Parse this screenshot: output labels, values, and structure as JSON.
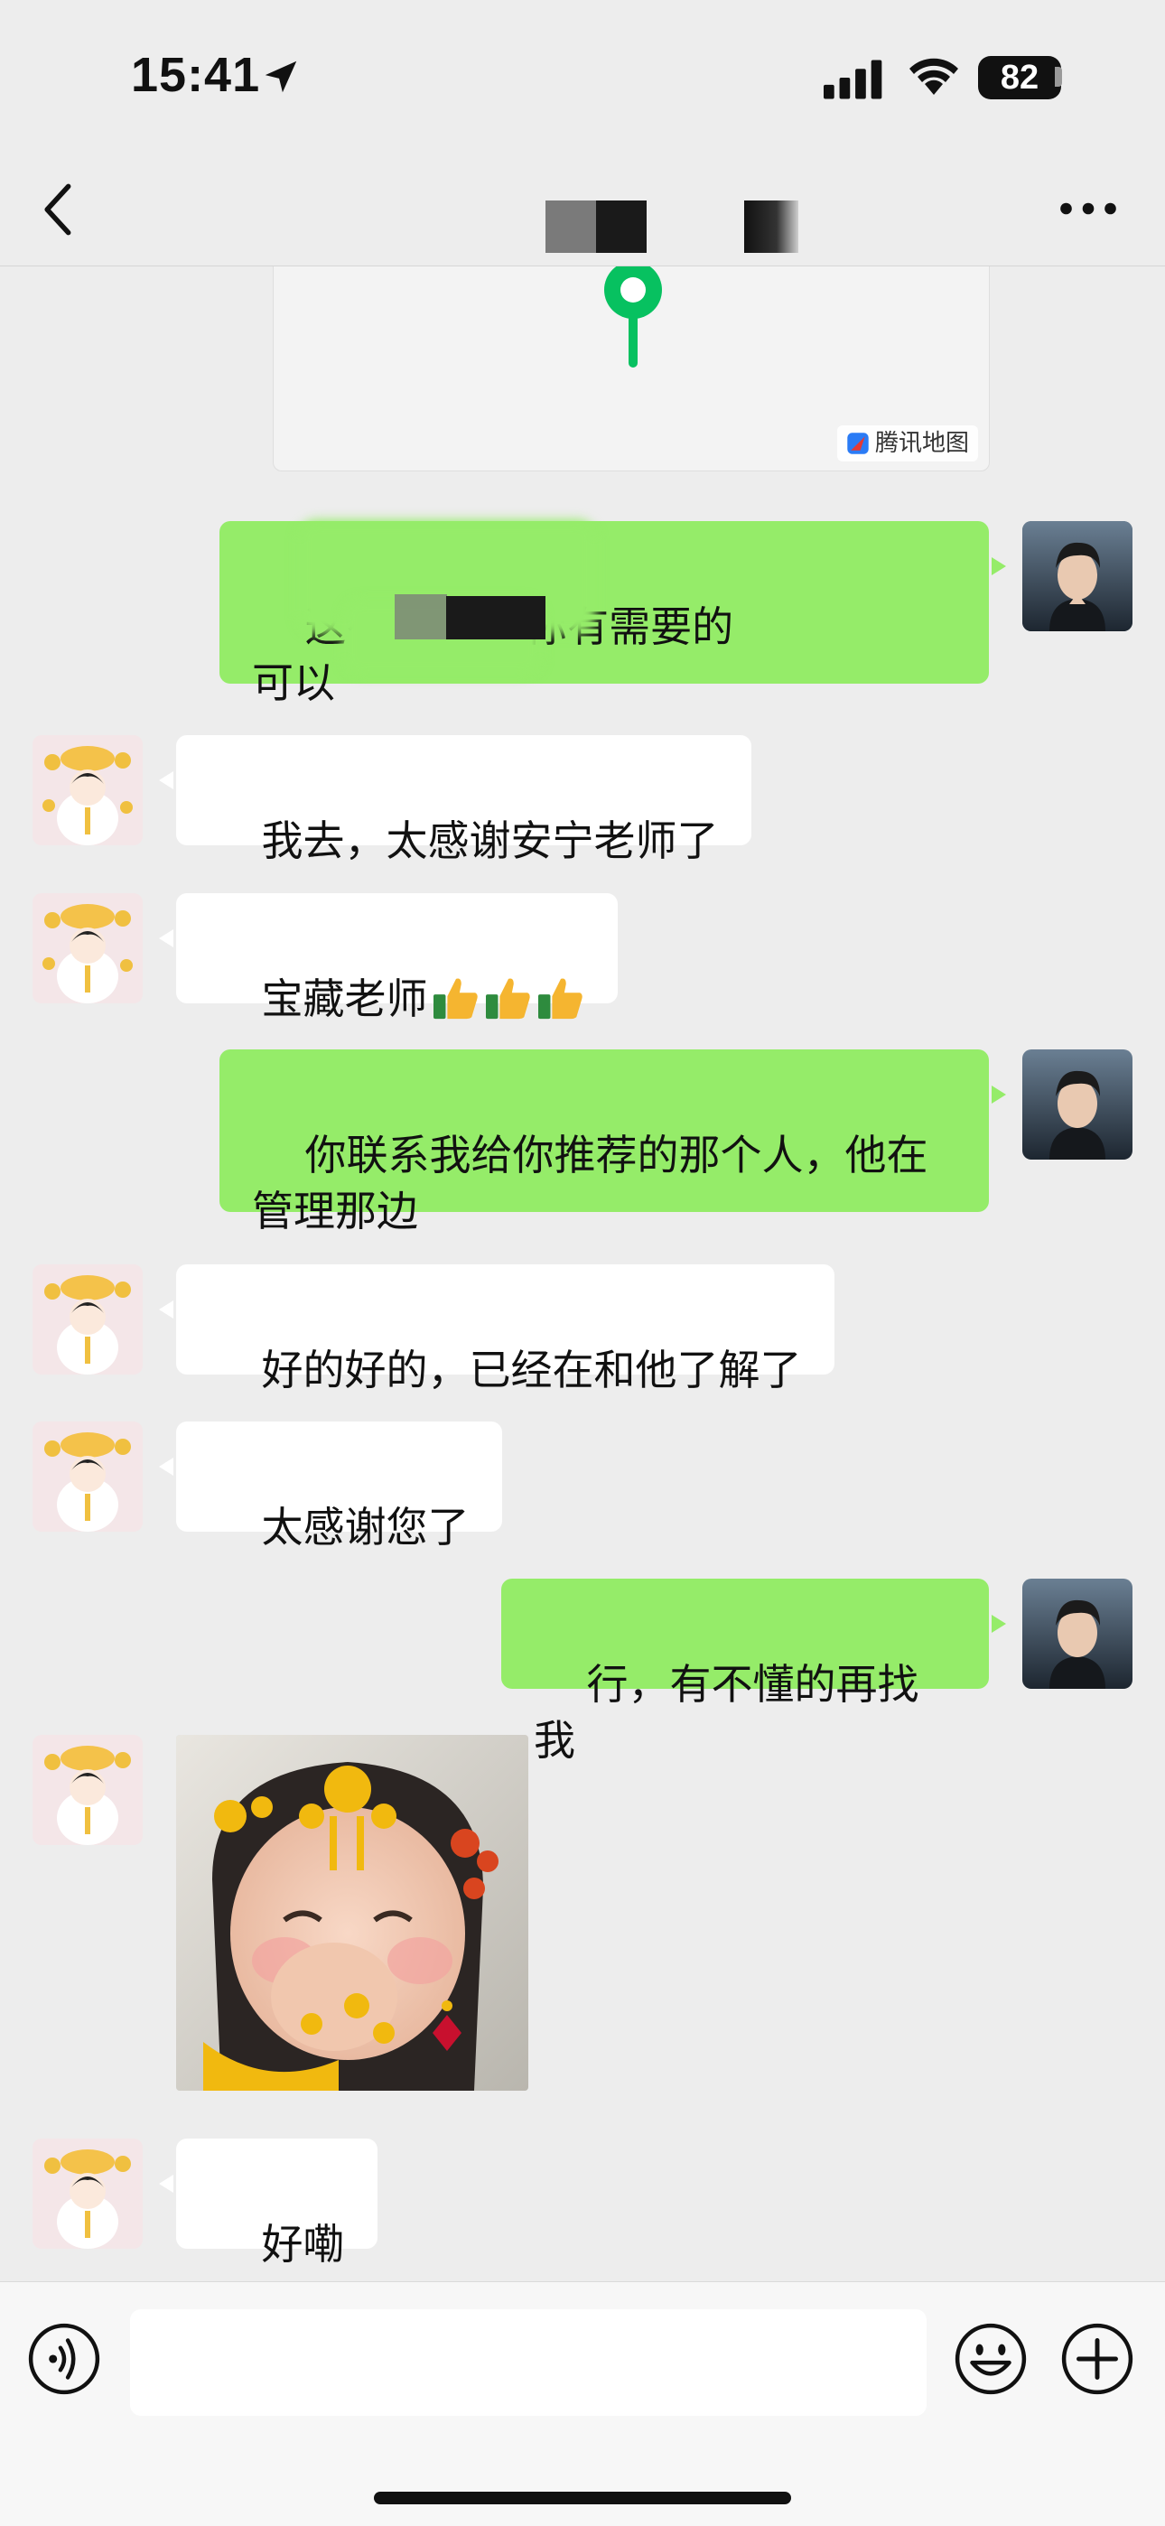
{
  "status_bar": {
    "time": "15:41",
    "battery": "82"
  },
  "nav": {
    "title": "",
    "back_icon": "chevron-left-icon",
    "more_icon": "more-dots-icon"
  },
  "map_card": {
    "provider": "腾讯地图"
  },
  "messages": [
    {
      "side": "out",
      "text": "这有 仓库，你有需要的\n可以",
      "partially_redacted": true
    },
    {
      "side": "in",
      "text": "我去，太感谢安宁老师了"
    },
    {
      "side": "in",
      "text": "宝藏老师",
      "emoji": [
        "thumbs-up",
        "thumbs-up",
        "thumbs-up"
      ]
    },
    {
      "side": "out",
      "text": "你联系我给你推荐的那个人，他在\n管理那边"
    },
    {
      "side": "in",
      "text": "好的好的，已经在和他了解了"
    },
    {
      "side": "in",
      "text": "太感谢您了"
    },
    {
      "side": "out",
      "text": "行，有不懂的再找我"
    },
    {
      "side": "in",
      "type": "image",
      "description_icon": "sticker-image"
    },
    {
      "side": "in",
      "text": "好嘞"
    }
  ],
  "input_bar": {
    "value": "",
    "voice_icon": "voice-icon",
    "emoji_icon": "emoji-icon",
    "plus_icon": "plus-icon"
  },
  "colors": {
    "background": "#ededed",
    "outgoing_bubble": "#95ec69",
    "incoming_bubble": "#ffffff",
    "map_pin": "#07c160"
  }
}
